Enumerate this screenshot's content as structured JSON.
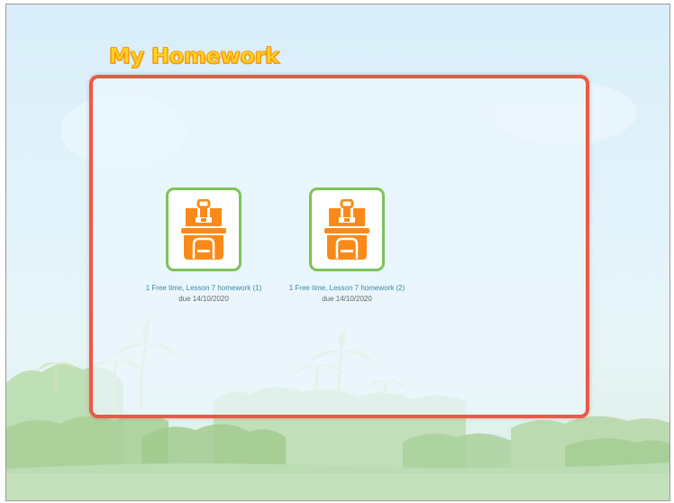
{
  "page": {
    "title": "My Homework"
  },
  "homework": [
    {
      "name": "1 Free time, Lesson 7 homework (1)",
      "due": "due 14/10/2020",
      "icon": "backpack-icon"
    },
    {
      "name": "1 Free time, Lesson 7 homework (2)",
      "due": "due 14/10/2020",
      "icon": "backpack-icon"
    }
  ],
  "colors": {
    "panel_border": "#ea5a48",
    "tile_border": "#7cc35a",
    "backpack": "#f98a1a",
    "title_fill": "#ffd21c",
    "title_outline": "#f39a1d",
    "link": "#3d88a6"
  }
}
